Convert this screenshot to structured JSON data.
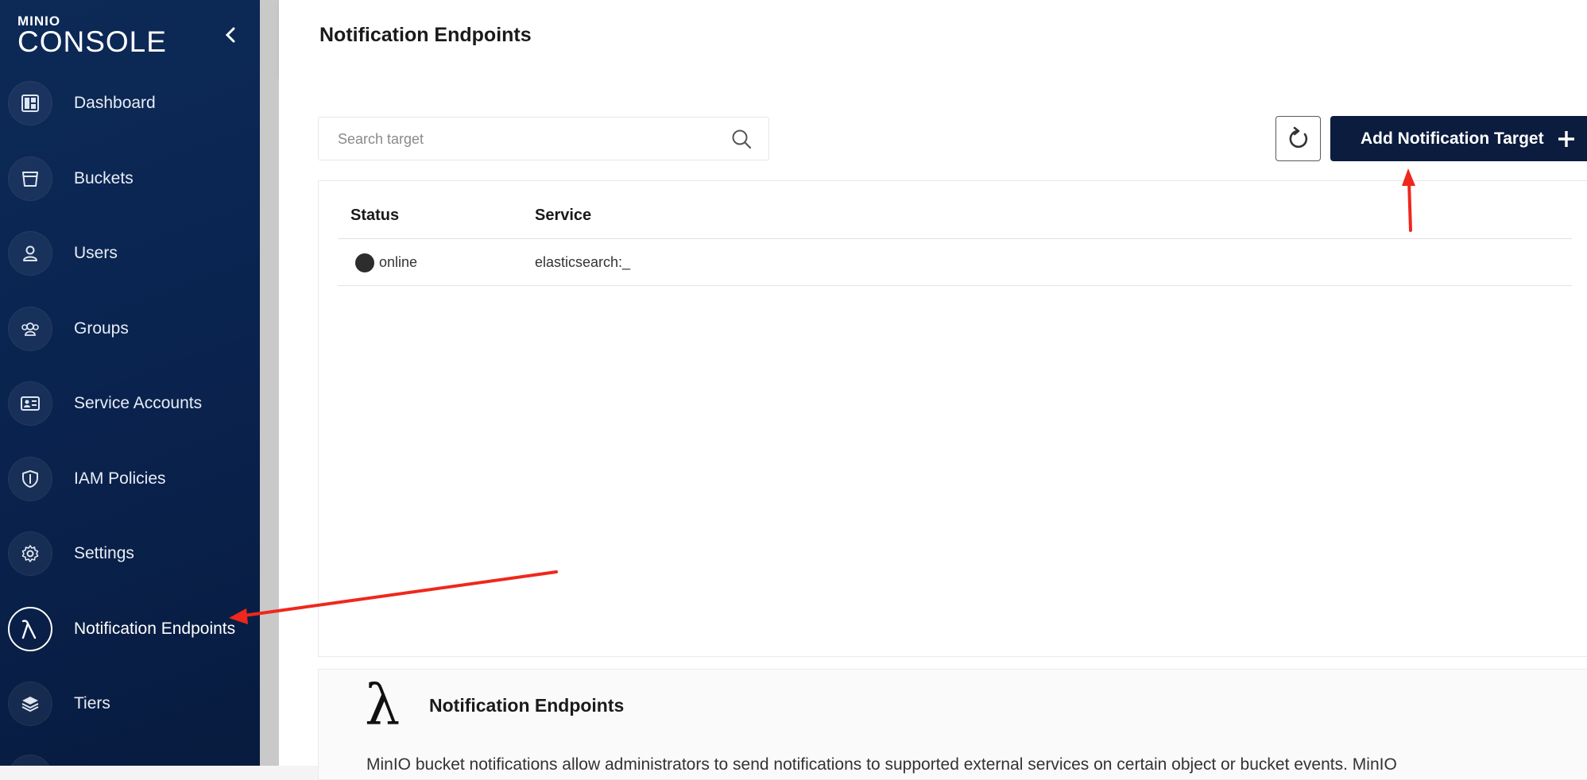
{
  "logo": {
    "small": "MINIO",
    "big": "CONSOLE"
  },
  "sidebar": {
    "items": [
      {
        "label": "Dashboard",
        "icon": "dashboard-icon"
      },
      {
        "label": "Buckets",
        "icon": "bucket-icon"
      },
      {
        "label": "Users",
        "icon": "user-icon"
      },
      {
        "label": "Groups",
        "icon": "groups-icon"
      },
      {
        "label": "Service Accounts",
        "icon": "service-account-icon"
      },
      {
        "label": "IAM Policies",
        "icon": "shield-icon"
      },
      {
        "label": "Settings",
        "icon": "gear-icon"
      },
      {
        "label": "Notification Endpoints",
        "icon": "lambda-icon",
        "active": true
      },
      {
        "label": "Tiers",
        "icon": "layers-icon"
      }
    ]
  },
  "header": {
    "title": "Notification Endpoints"
  },
  "search": {
    "placeholder": "Search target",
    "value": ""
  },
  "toolbar": {
    "add_label": "Add Notification Target"
  },
  "table": {
    "columns": [
      "Status",
      "Service"
    ],
    "rows": [
      {
        "status": "online",
        "service": "elasticsearch:_"
      }
    ]
  },
  "info": {
    "title": "Notification Endpoints",
    "text": "MinIO bucket notifications allow administrators to send notifications to supported external services on certain object or bucket events. MinIO"
  },
  "colors": {
    "sidebar": "#0a2450",
    "primary_button": "#0b1c3f",
    "annotation_arrow": "#f0271c",
    "status_online": "#2d2d2d"
  }
}
